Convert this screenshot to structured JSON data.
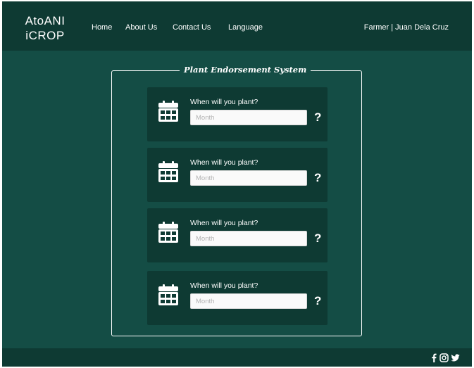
{
  "brand": {
    "line1": "AtoANI",
    "line2": "iCROP"
  },
  "nav": {
    "home": "Home",
    "about": "About Us",
    "contact": "Contact Us",
    "language": "Language"
  },
  "user": "Farmer | Juan Dela Cruz",
  "panel": {
    "title": "Plant Endorsement System"
  },
  "cards": [
    {
      "label": "When will you plant?",
      "placeholder": "Month",
      "help": "?"
    },
    {
      "label": "When will you plant?",
      "placeholder": "Month",
      "help": "?"
    },
    {
      "label": "When will you plant?",
      "placeholder": "Month",
      "help": "?"
    },
    {
      "label": "When will you plant?",
      "placeholder": "Month",
      "help": "?"
    }
  ],
  "footer": {
    "icons": [
      "facebook-icon",
      "instagram-icon",
      "twitter-icon"
    ]
  },
  "colors": {
    "background": "#144d45",
    "bar": "#0e3a33",
    "text": "#ffffff"
  }
}
